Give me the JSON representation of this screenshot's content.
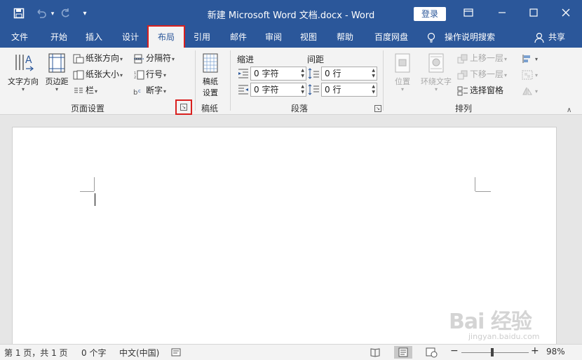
{
  "titlebar": {
    "title": "新建 Microsoft Word 文档.docx  -  Word",
    "login": "登录",
    "icons": [
      "save-icon",
      "undo-icon",
      "redo-icon",
      "customize-qat-icon",
      "ribbon-display-icon",
      "minimize-icon",
      "maximize-icon",
      "close-icon"
    ]
  },
  "tabs": [
    {
      "label": "文件"
    },
    {
      "label": "开始"
    },
    {
      "label": "插入"
    },
    {
      "label": "设计"
    },
    {
      "label": "布局",
      "active": true
    },
    {
      "label": "引用"
    },
    {
      "label": "邮件"
    },
    {
      "label": "审阅"
    },
    {
      "label": "视图"
    },
    {
      "label": "帮助"
    },
    {
      "label": "百度网盘"
    }
  ],
  "tell_me": "操作说明搜索",
  "share": "共享",
  "ribbon": {
    "page_setup": {
      "text_direction": "文字方向",
      "margins": "页边距",
      "orientation": "纸张方向",
      "size": "纸张大小",
      "columns": "栏",
      "breaks": "分隔符",
      "line_numbers": "行号",
      "hyphenation": "断字",
      "label": "页面设置"
    },
    "manuscript": {
      "setup": "稿纸设置",
      "setup_line1": "稿纸",
      "setup_line2": "设置",
      "label": "稿纸"
    },
    "paragraph": {
      "indent_label": "缩进",
      "spacing_label": "间距",
      "indent_left": "0 字符",
      "indent_right": "0 字符",
      "spacing_before": "0 行",
      "spacing_after": "0 行",
      "label": "段落"
    },
    "arrange": {
      "position": "位置",
      "wrap_text": "环绕文字",
      "bring_forward": "上移一层",
      "send_backward": "下移一层",
      "selection_pane": "选择窗格",
      "label": "排列"
    }
  },
  "statusbar": {
    "page": "第 1 页，共 1 页",
    "words": "0 个字",
    "language": "中文(中国)",
    "zoom": "98%",
    "zoom_minus": "−",
    "zoom_plus": "+"
  },
  "watermark": {
    "text": "Bai 经验",
    "sub": "jingyan.baidu.com"
  },
  "colors": {
    "accent": "#2b579a",
    "highlight": "#d9201f",
    "ribbon_bg": "#f3f3f3"
  }
}
